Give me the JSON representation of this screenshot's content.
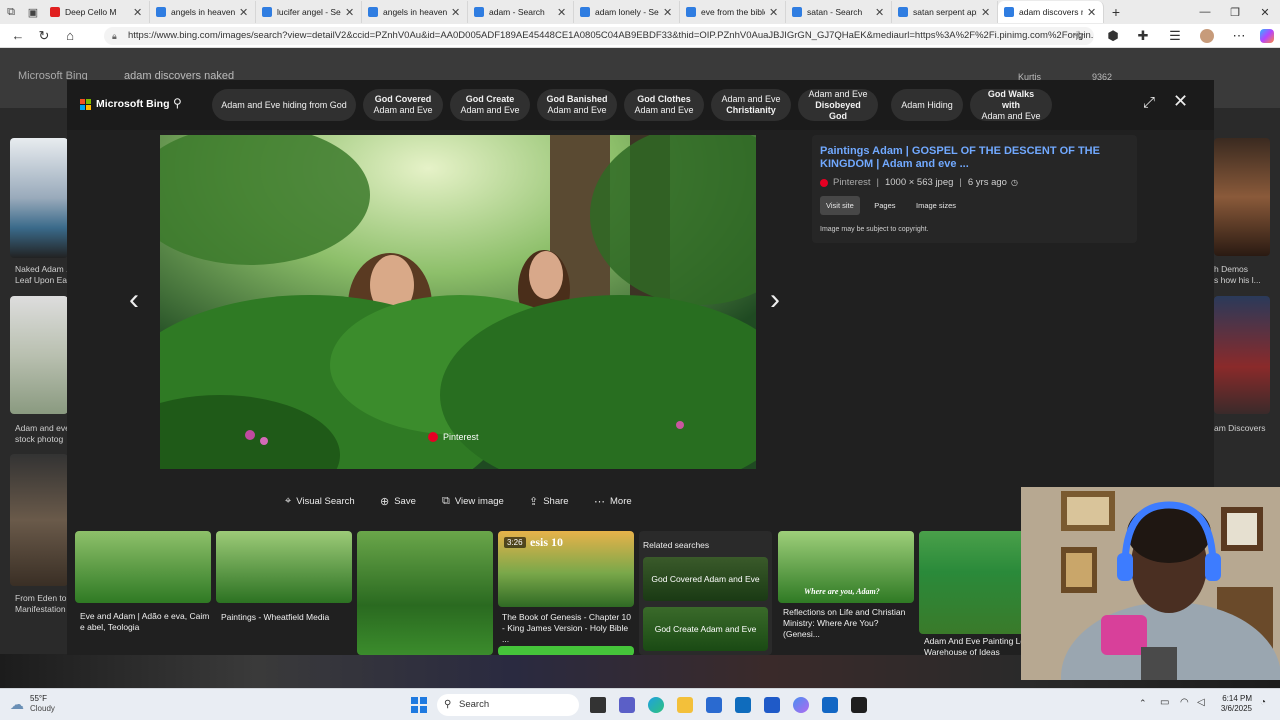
{
  "browser": {
    "tabs": [
      {
        "title": "Deep Cello M",
        "fav": "#e02020"
      },
      {
        "title": "angels in heaven -",
        "fav": "#2f7de1"
      },
      {
        "title": "lucifer angel - Sear",
        "fav": "#2f7de1"
      },
      {
        "title": "angels in heaven -",
        "fav": "#2f7de1"
      },
      {
        "title": "adam - Search",
        "fav": "#2f7de1"
      },
      {
        "title": "adam lonely - Sear",
        "fav": "#2f7de1"
      },
      {
        "title": "eve from the bible",
        "fav": "#2f7de1"
      },
      {
        "title": "satan - Search",
        "fav": "#2f7de1"
      },
      {
        "title": "satan serpent appl",
        "fav": "#2f7de1"
      },
      {
        "title": "adam discovers na",
        "fav": "#2f7de1"
      }
    ],
    "url": "https://www.bing.com/images/search?view=detailV2&ccid=PZnhV0Au&id=AA0D005ADF189AE45448CE1A0805C04AB9EBDF33&thid=OIP.PZnhV0AuaJBJIGrGN_GJ7QHaEK&mediaurl=https%3A%2F%2Fi.pinimg.com%2Forigin..."
  },
  "bg_page": {
    "search_text": "adam discovers naked",
    "user": "Kurtis",
    "points": "9362",
    "left_captions": [
      "Naked Adam ...\nLeaf Upon Ea",
      "Adam and eve\nstock photog",
      "From Eden to\nManifestation"
    ],
    "right_captions": [
      "h Demos\ns how his l...",
      "am Discovers"
    ]
  },
  "modal": {
    "logo": "Microsoft Bing",
    "chips": [
      {
        "line1": "Adam and Eve hiding from God",
        "line2": "",
        "bold": ""
      },
      {
        "line1": "God Covered",
        "line2": "Adam and Eve",
        "bold": "1"
      },
      {
        "line1": "God Create",
        "line2": "Adam and Eve",
        "bold": "1"
      },
      {
        "line1": "God Banished",
        "line2": "Adam and Eve",
        "bold": "1"
      },
      {
        "line1": "God Clothes",
        "line2": "Adam and Eve",
        "bold": "1"
      },
      {
        "line1": "Adam and Eve",
        "line2": "Christianity",
        "bold": "2"
      },
      {
        "line1": "Adam and Eve",
        "line2": "Disobeyed God",
        "bold": "2"
      },
      {
        "line1": "Adam Hiding",
        "line2": "",
        "bold": ""
      },
      {
        "line1": "God Walks with",
        "line2": "Adam and Eve",
        "bold": "1"
      }
    ],
    "image_source_badge": "Pinterest",
    "info": {
      "title": "Paintings Adam | GOSPEL OF THE DESCENT OF THE KINGDOM | Adam and eve ...",
      "source": "Pinterest",
      "dims": "1000 × 563 jpeg",
      "age": "6 yrs ago",
      "buttons": [
        "Visit site",
        "Pages",
        "Image sizes"
      ],
      "copyright": "Image may be subject to copyright."
    },
    "actions": [
      "Visual Search",
      "Save",
      "View image",
      "Share",
      "More"
    ],
    "related": [
      {
        "caption": "Eve and Adam | Adão e eva, Caim e abel, Teologia"
      },
      {
        "caption": "Paintings - Wheatfield Media"
      },
      {
        "caption": ""
      },
      {
        "caption": "The Book of Genesis - Chapter 10 - King James Version - Holy Bible ...",
        "badge": "3:26",
        "overlay": "esis 10"
      },
      {
        "caption": "Reflections on Life and Christian Ministry: Where Are You? (Genesi...",
        "overlay": "Where are you, Adam?"
      },
      {
        "caption": "Adam And Eve Painting Lds Warehouse of Ideas"
      }
    ],
    "related_searches": {
      "heading": "Related searches",
      "items": [
        "God Covered Adam and Eve",
        "God Create Adam and Eve"
      ]
    }
  },
  "taskbar": {
    "weather_temp": "55°F",
    "weather_desc": "Cloudy",
    "search_placeholder": "Search",
    "time": "6:14 PM",
    "date": "3/6/2025"
  }
}
